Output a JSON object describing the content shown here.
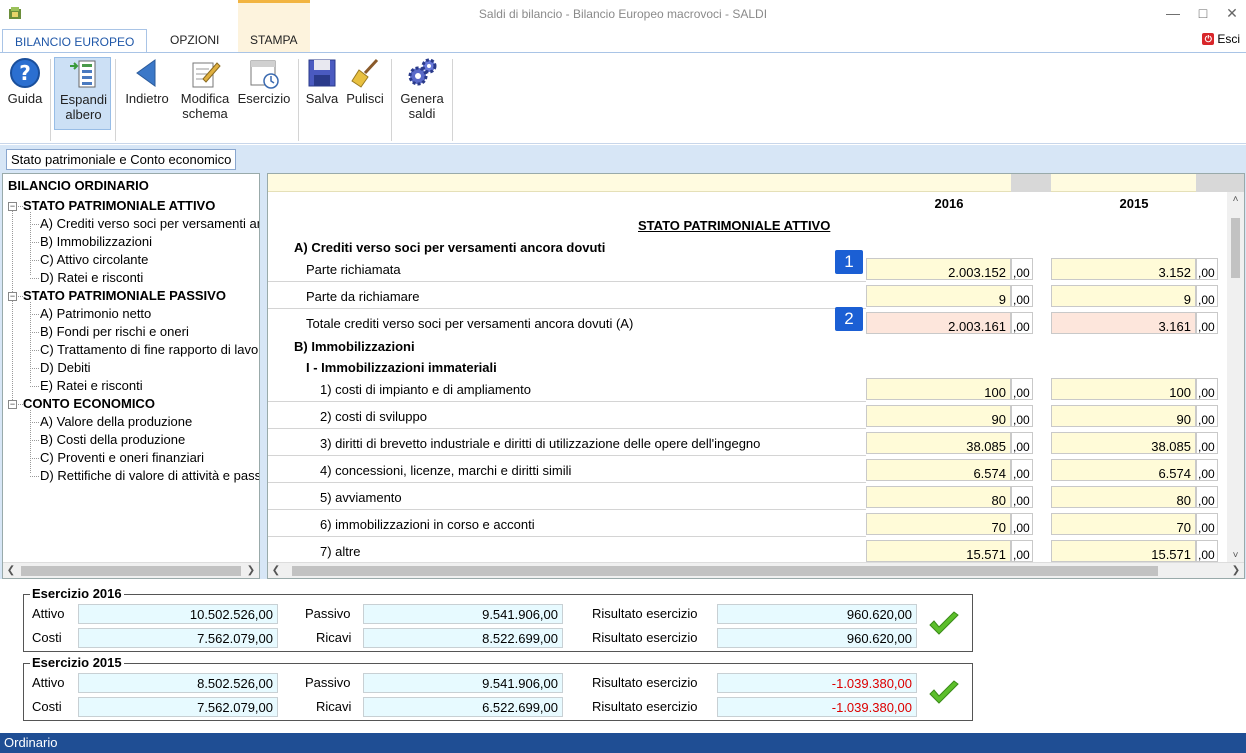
{
  "window": {
    "title": "Saldi di bilancio - Bilancio Europeo macrovoci - SALDI"
  },
  "ribbon_tabs": [
    "BILANCIO EUROPEO",
    "OPZIONI",
    "STAMPA"
  ],
  "esci_label": "Esci",
  "toolbar": {
    "guida": "Guida",
    "espandi": "Espandi albero",
    "indietro": "Indietro",
    "modifica": "Modifica schema",
    "esercizio": "Esercizio",
    "salva": "Salva",
    "pulisci": "Pulisci",
    "genera": "Genera saldi"
  },
  "doc_tab": "Stato patrimoniale e Conto economico",
  "tree": {
    "root": "BILANCIO ORDINARIO",
    "sections": [
      {
        "label": "STATO PATRIMONIALE ATTIVO",
        "items": [
          "A) Crediti verso soci per versamenti ancora dovuti",
          "B) Immobilizzazioni",
          "C) Attivo circolante",
          "D) Ratei e risconti"
        ]
      },
      {
        "label": "STATO PATRIMONIALE PASSIVO",
        "items": [
          "A) Patrimonio netto",
          "B) Fondi per rischi e oneri",
          "C) Trattamento di fine rapporto di lavoro",
          "D) Debiti",
          "E) Ratei e risconti"
        ]
      },
      {
        "label": "CONTO ECONOMICO",
        "items": [
          "A) Valore della produzione",
          "B) Costi della produzione",
          "C) Proventi e oneri finanziari",
          "D) Rettifiche di valore di attività e passività"
        ]
      }
    ]
  },
  "grid": {
    "year1": "2016",
    "year2": "2015",
    "section_title": "STATO PATRIMONIALE ATTIVO",
    "decimals": ",00",
    "headings": {
      "a": "A) Crediti verso soci per versamenti ancora dovuti",
      "b": "B) Immobilizzazioni",
      "b1": "I - Immobilizzazioni immateriali"
    },
    "rows": [
      {
        "label": "Parte richiamata",
        "v2016": "2.003.152",
        "v2015": "3.152",
        "badge": "1"
      },
      {
        "label": "Parte da richiamare",
        "v2016": "9",
        "v2015": "9"
      },
      {
        "label": "Totale crediti verso soci per versamenti ancora dovuti (A)",
        "v2016": "2.003.161",
        "v2015": "3.161",
        "badge": "2"
      },
      {
        "label": "1) costi di impianto e di ampliamento",
        "v2016": "100",
        "v2015": "100"
      },
      {
        "label": "2) costi di sviluppo",
        "v2016": "90",
        "v2015": "90"
      },
      {
        "label": "3) diritti di brevetto industriale e diritti di utilizzazione delle opere dell'ingegno",
        "v2016": "38.085",
        "v2015": "38.085"
      },
      {
        "label": "4) concessioni, licenze, marchi e diritti simili",
        "v2016": "6.574",
        "v2015": "6.574"
      },
      {
        "label": "5) avviamento",
        "v2016": "80",
        "v2015": "80"
      },
      {
        "label": "6) immobilizzazioni in corso e acconti",
        "v2016": "70",
        "v2015": "70"
      },
      {
        "label": "7) altre",
        "v2016": "15.571",
        "v2015": "15.571"
      }
    ]
  },
  "summary": {
    "labels": {
      "attivo": "Attivo",
      "costi": "Costi",
      "passivo": "Passivo",
      "ricavi": "Ricavi",
      "risultato": "Risultato esercizio"
    },
    "e2016": {
      "title": "Esercizio 2016",
      "attivo": "10.502.526,00",
      "costi": "7.562.079,00",
      "passivo": "9.541.906,00",
      "ricavi": "8.522.699,00",
      "risultato1": "960.620,00",
      "risultato2": "960.620,00"
    },
    "e2015": {
      "title": "Esercizio 2015",
      "attivo": "8.502.526,00",
      "costi": "7.562.079,00",
      "passivo": "9.541.906,00",
      "ricavi": "6.522.699,00",
      "risultato1": "-1.039.380,00",
      "risultato2": "-1.039.380,00"
    }
  },
  "status": "Ordinario",
  "colors": {
    "accent": "#1f57a8",
    "status_bar": "#1f4e94",
    "negative": "#dd0000",
    "input_yellow": "#fffbd8"
  }
}
